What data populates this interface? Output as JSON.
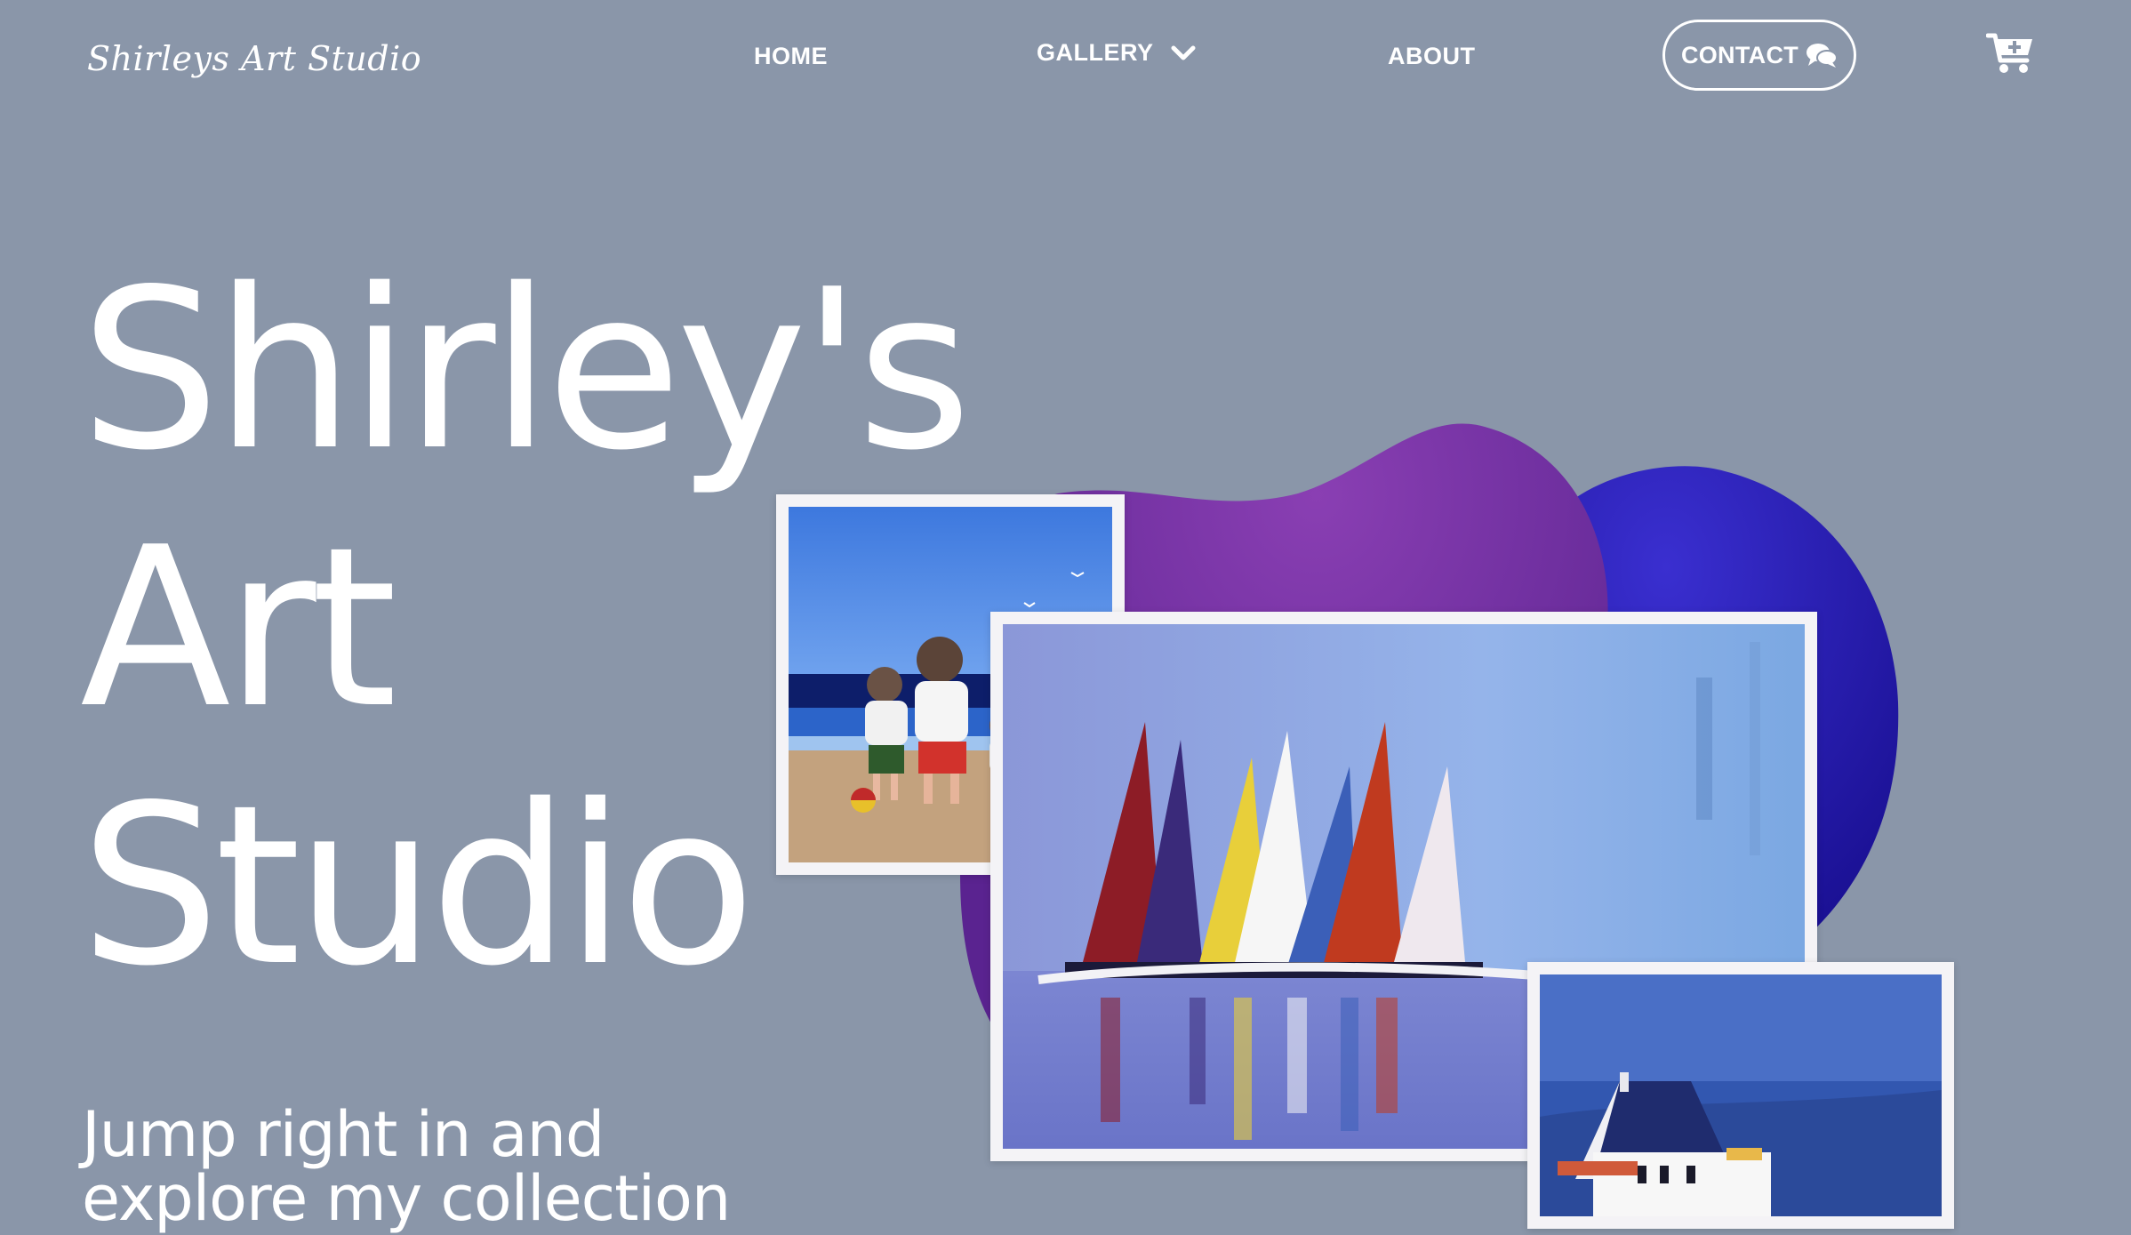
{
  "header": {
    "brand": "Shirleys Art Studio",
    "nav": {
      "home": "HOME",
      "gallery": "GALLERY",
      "about": "ABOUT",
      "contact": "CONTACT"
    },
    "icons": [
      "chevron-down-icon",
      "chat-bubbles-icon",
      "cart-add-icon"
    ]
  },
  "hero": {
    "title_lines": [
      "Shirley's",
      "Art",
      "Studio"
    ],
    "subtitle_lines": [
      "Jump right in and",
      "explore my collection"
    ]
  },
  "colors": {
    "background": "#8a96a9",
    "blob_purple": "#6d2f9a",
    "blob_blue": "#2a1fb0",
    "text": "#ffffff"
  },
  "gallery_images": [
    "children-at-beach-painting",
    "sailboats-painting",
    "cottage-painting"
  ]
}
